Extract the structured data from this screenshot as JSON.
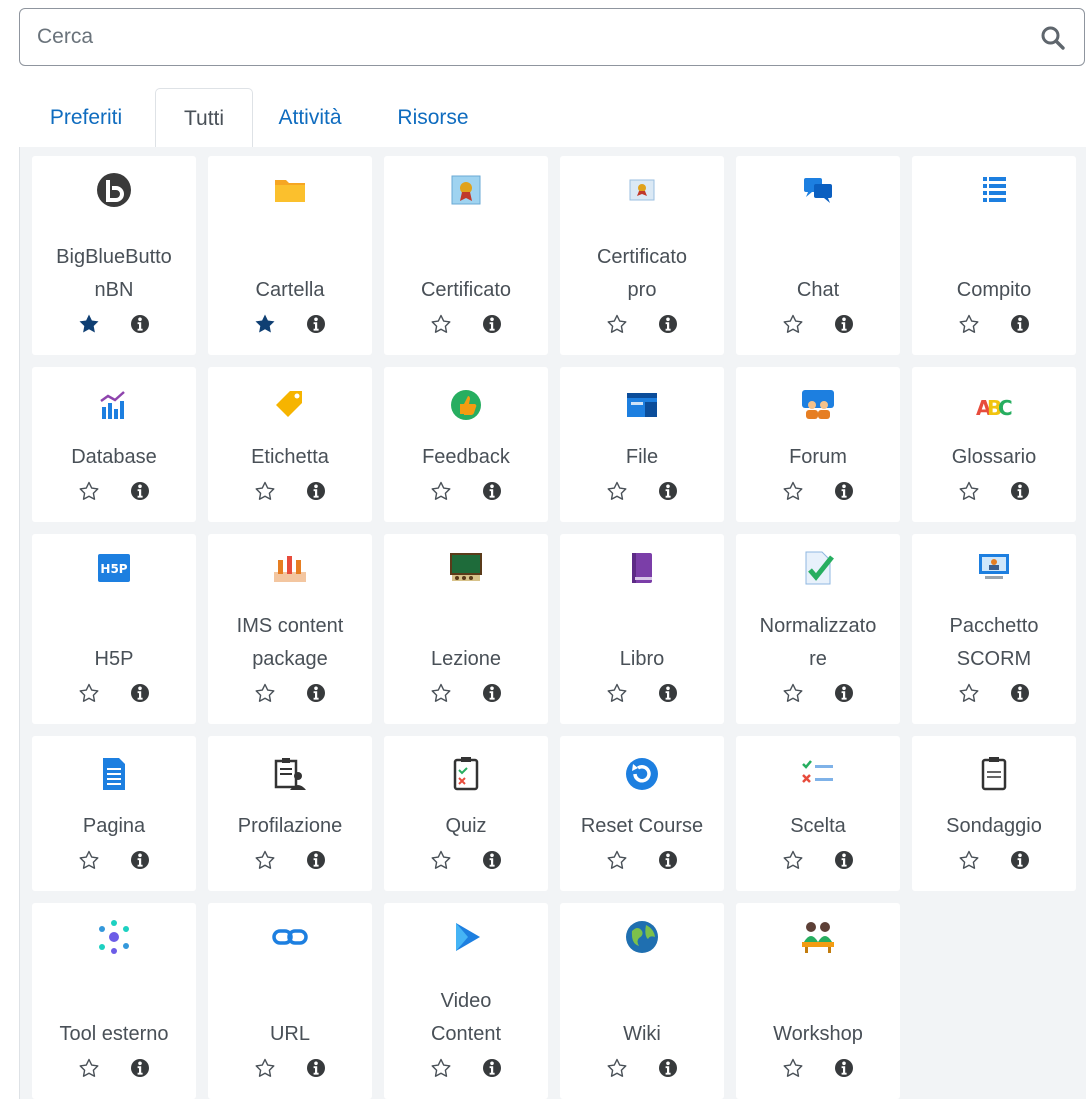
{
  "search": {
    "placeholder": "Cerca",
    "icon": "search-icon"
  },
  "tabs": [
    {
      "label": "Preferiti",
      "active": false
    },
    {
      "label": "Tutti",
      "active": true
    },
    {
      "label": "Attività",
      "active": false
    },
    {
      "label": "Risorse",
      "active": false
    }
  ],
  "colors": {
    "link": "#0f6cbf",
    "text": "#495057",
    "panel": "#f2f4f6",
    "star_filled": "#0f3f73"
  },
  "modules": [
    {
      "name": "BigBlueButto nBN",
      "lines": [
        "BigBlueButto",
        "nBN"
      ],
      "icon": "bigbluebutton-icon",
      "favourite": true
    },
    {
      "name": "Cartella",
      "lines": [
        "Cartella"
      ],
      "icon": "folder-icon",
      "favourite": true
    },
    {
      "name": "Certificato",
      "lines": [
        "Certificato"
      ],
      "icon": "certificate-icon",
      "favourite": false
    },
    {
      "name": "Certificato pro",
      "lines": [
        "Certificato",
        "pro"
      ],
      "icon": "certificate-pro-icon",
      "favourite": false
    },
    {
      "name": "Chat",
      "lines": [
        "Chat"
      ],
      "icon": "chat-icon",
      "favourite": false
    },
    {
      "name": "Compito",
      "lines": [
        "Compito"
      ],
      "icon": "assignment-icon",
      "favourite": false
    },
    {
      "name": "Database",
      "lines": [
        "Database"
      ],
      "icon": "database-icon",
      "favourite": false
    },
    {
      "name": "Etichetta",
      "lines": [
        "Etichetta"
      ],
      "icon": "label-icon",
      "favourite": false
    },
    {
      "name": "Feedback",
      "lines": [
        "Feedback"
      ],
      "icon": "feedback-icon",
      "favourite": false
    },
    {
      "name": "File",
      "lines": [
        "File"
      ],
      "icon": "file-icon",
      "favourite": false
    },
    {
      "name": "Forum",
      "lines": [
        "Forum"
      ],
      "icon": "forum-icon",
      "favourite": false
    },
    {
      "name": "Glossario",
      "lines": [
        "Glossario"
      ],
      "icon": "glossary-icon",
      "favourite": false
    },
    {
      "name": "H5P",
      "lines": [
        "H5P"
      ],
      "icon": "h5p-icon",
      "favourite": false
    },
    {
      "name": "IMS content package",
      "lines": [
        "IMS content",
        "package"
      ],
      "icon": "ims-package-icon",
      "favourite": false
    },
    {
      "name": "Lezione",
      "lines": [
        "Lezione"
      ],
      "icon": "lesson-icon",
      "favourite": false
    },
    {
      "name": "Libro",
      "lines": [
        "Libro"
      ],
      "icon": "book-icon",
      "favourite": false
    },
    {
      "name": "Normalizzatore",
      "lines": [
        "Normalizzato",
        "re"
      ],
      "icon": "normalizer-icon",
      "favourite": false
    },
    {
      "name": "Pacchetto SCORM",
      "lines": [
        "Pacchetto",
        "SCORM"
      ],
      "icon": "scorm-icon",
      "favourite": false
    },
    {
      "name": "Pagina",
      "lines": [
        "Pagina"
      ],
      "icon": "page-icon",
      "favourite": false
    },
    {
      "name": "Profilazione",
      "lines": [
        "Profilazione"
      ],
      "icon": "profiling-icon",
      "favourite": false
    },
    {
      "name": "Quiz",
      "lines": [
        "Quiz"
      ],
      "icon": "quiz-icon",
      "favourite": false
    },
    {
      "name": "Reset Course",
      "lines": [
        "Reset Course"
      ],
      "icon": "reset-course-icon",
      "favourite": false
    },
    {
      "name": "Scelta",
      "lines": [
        "Scelta"
      ],
      "icon": "choice-icon",
      "favourite": false
    },
    {
      "name": "Sondaggio",
      "lines": [
        "Sondaggio"
      ],
      "icon": "survey-icon",
      "favourite": false
    },
    {
      "name": "Tool esterno",
      "lines": [
        "Tool esterno"
      ],
      "icon": "external-tool-icon",
      "favourite": false
    },
    {
      "name": "URL",
      "lines": [
        "URL"
      ],
      "icon": "url-icon",
      "favourite": false
    },
    {
      "name": "Video Content",
      "lines": [
        "Video",
        "Content"
      ],
      "icon": "video-content-icon",
      "favourite": false
    },
    {
      "name": "Wiki",
      "lines": [
        "Wiki"
      ],
      "icon": "wiki-icon",
      "favourite": false
    },
    {
      "name": "Workshop",
      "lines": [
        "Workshop"
      ],
      "icon": "workshop-icon",
      "favourite": false
    }
  ]
}
